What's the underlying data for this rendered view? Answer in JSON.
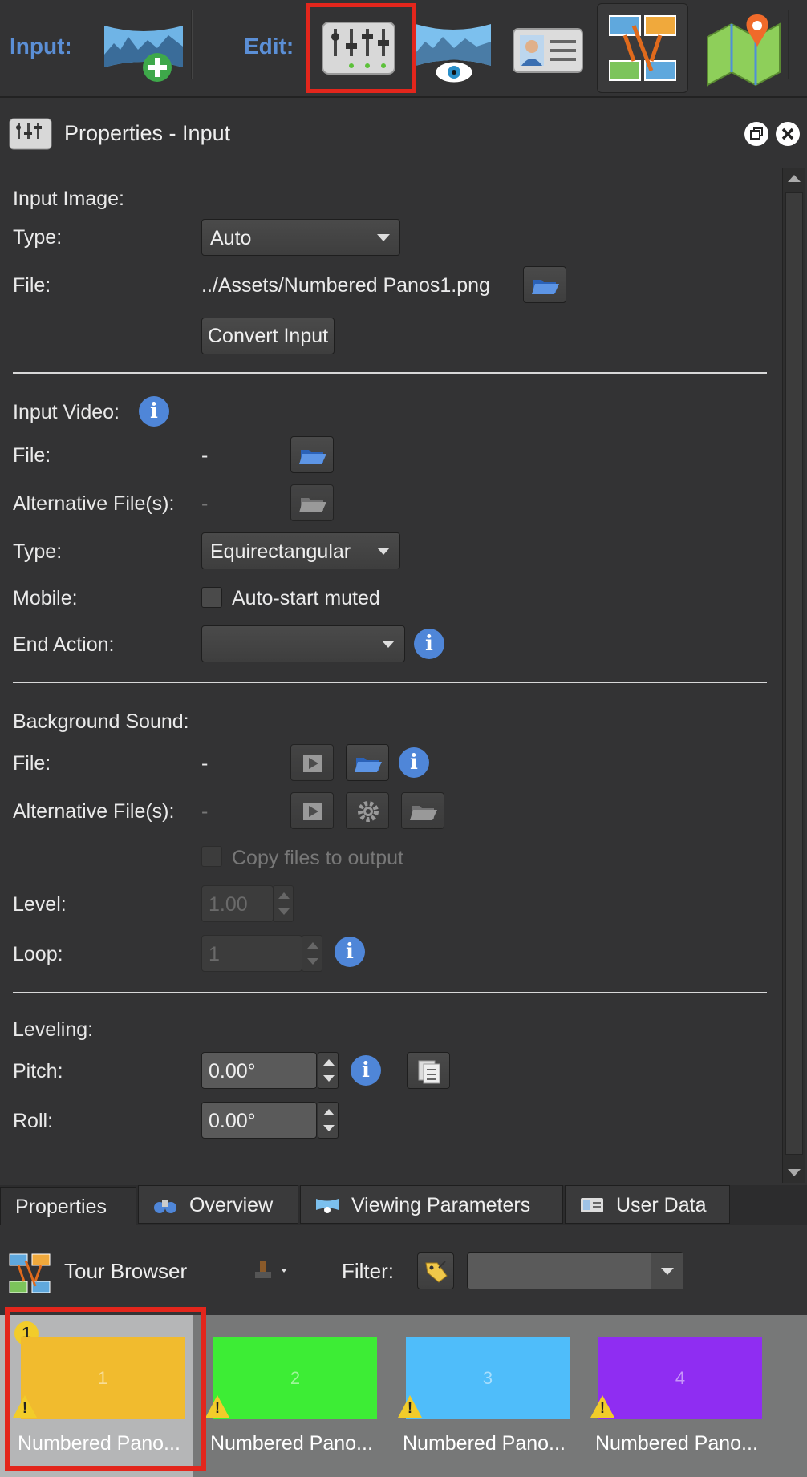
{
  "toolbar": {
    "input_label": "Input:",
    "edit_label": "Edit:",
    "icons": [
      "add-panorama-icon",
      "properties-sliders-icon",
      "viewing-parameters-icon",
      "user-data-icon",
      "tour-browser-icon",
      "map-icon"
    ]
  },
  "panel": {
    "title": "Properties - Input"
  },
  "input_image": {
    "section": "Input Image:",
    "type_label": "Type:",
    "type_value": "Auto",
    "file_label": "File:",
    "file_value": "../Assets/Numbered Panos1.png",
    "convert_button": "Convert Input"
  },
  "input_video": {
    "section": "Input Video:",
    "file_label": "File:",
    "file_value": "-",
    "alt_label": "Alternative File(s):",
    "alt_value": "-",
    "type_label": "Type:",
    "type_value": "Equirectangular",
    "mobile_label": "Mobile:",
    "mobile_checkbox": "Auto-start muted",
    "end_action_label": "End Action:",
    "end_action_value": ""
  },
  "background_sound": {
    "section": "Background Sound:",
    "file_label": "File:",
    "file_value": "-",
    "alt_label": "Alternative File(s):",
    "alt_value": "-",
    "copy_checkbox": "Copy files to output",
    "level_label": "Level:",
    "level_value": "1.00",
    "loop_label": "Loop:",
    "loop_value": "1"
  },
  "leveling": {
    "section": "Leveling:",
    "pitch_label": "Pitch:",
    "pitch_value": "0.00°",
    "roll_label": "Roll:",
    "roll_value": "0.00°"
  },
  "tabs": [
    {
      "label": "Properties",
      "active": true
    },
    {
      "label": "Overview",
      "icon": "binoculars-icon"
    },
    {
      "label": "Viewing Parameters",
      "icon": "viewing-parameters-icon"
    },
    {
      "label": "User Data",
      "icon": "user-data-icon"
    }
  ],
  "tour_browser": {
    "title": "Tour Browser",
    "filter_label": "Filter:",
    "filter_value": "",
    "thumbnails": [
      {
        "number": "1",
        "caption": "Numbered Pano...",
        "color": "#f1bb2e",
        "selected": true,
        "badge": "1"
      },
      {
        "number": "2",
        "caption": "Numbered Pano...",
        "color": "#3ded35"
      },
      {
        "number": "3",
        "caption": "Numbered Pano...",
        "color": "#4fbdfa"
      },
      {
        "number": "4",
        "caption": "Numbered Pano...",
        "color": "#8f2df2"
      }
    ]
  },
  "colors": {
    "accent_blue": "#5b8fd6",
    "highlight_red": "#e3261c",
    "warning_yellow": "#f2cc2a"
  }
}
